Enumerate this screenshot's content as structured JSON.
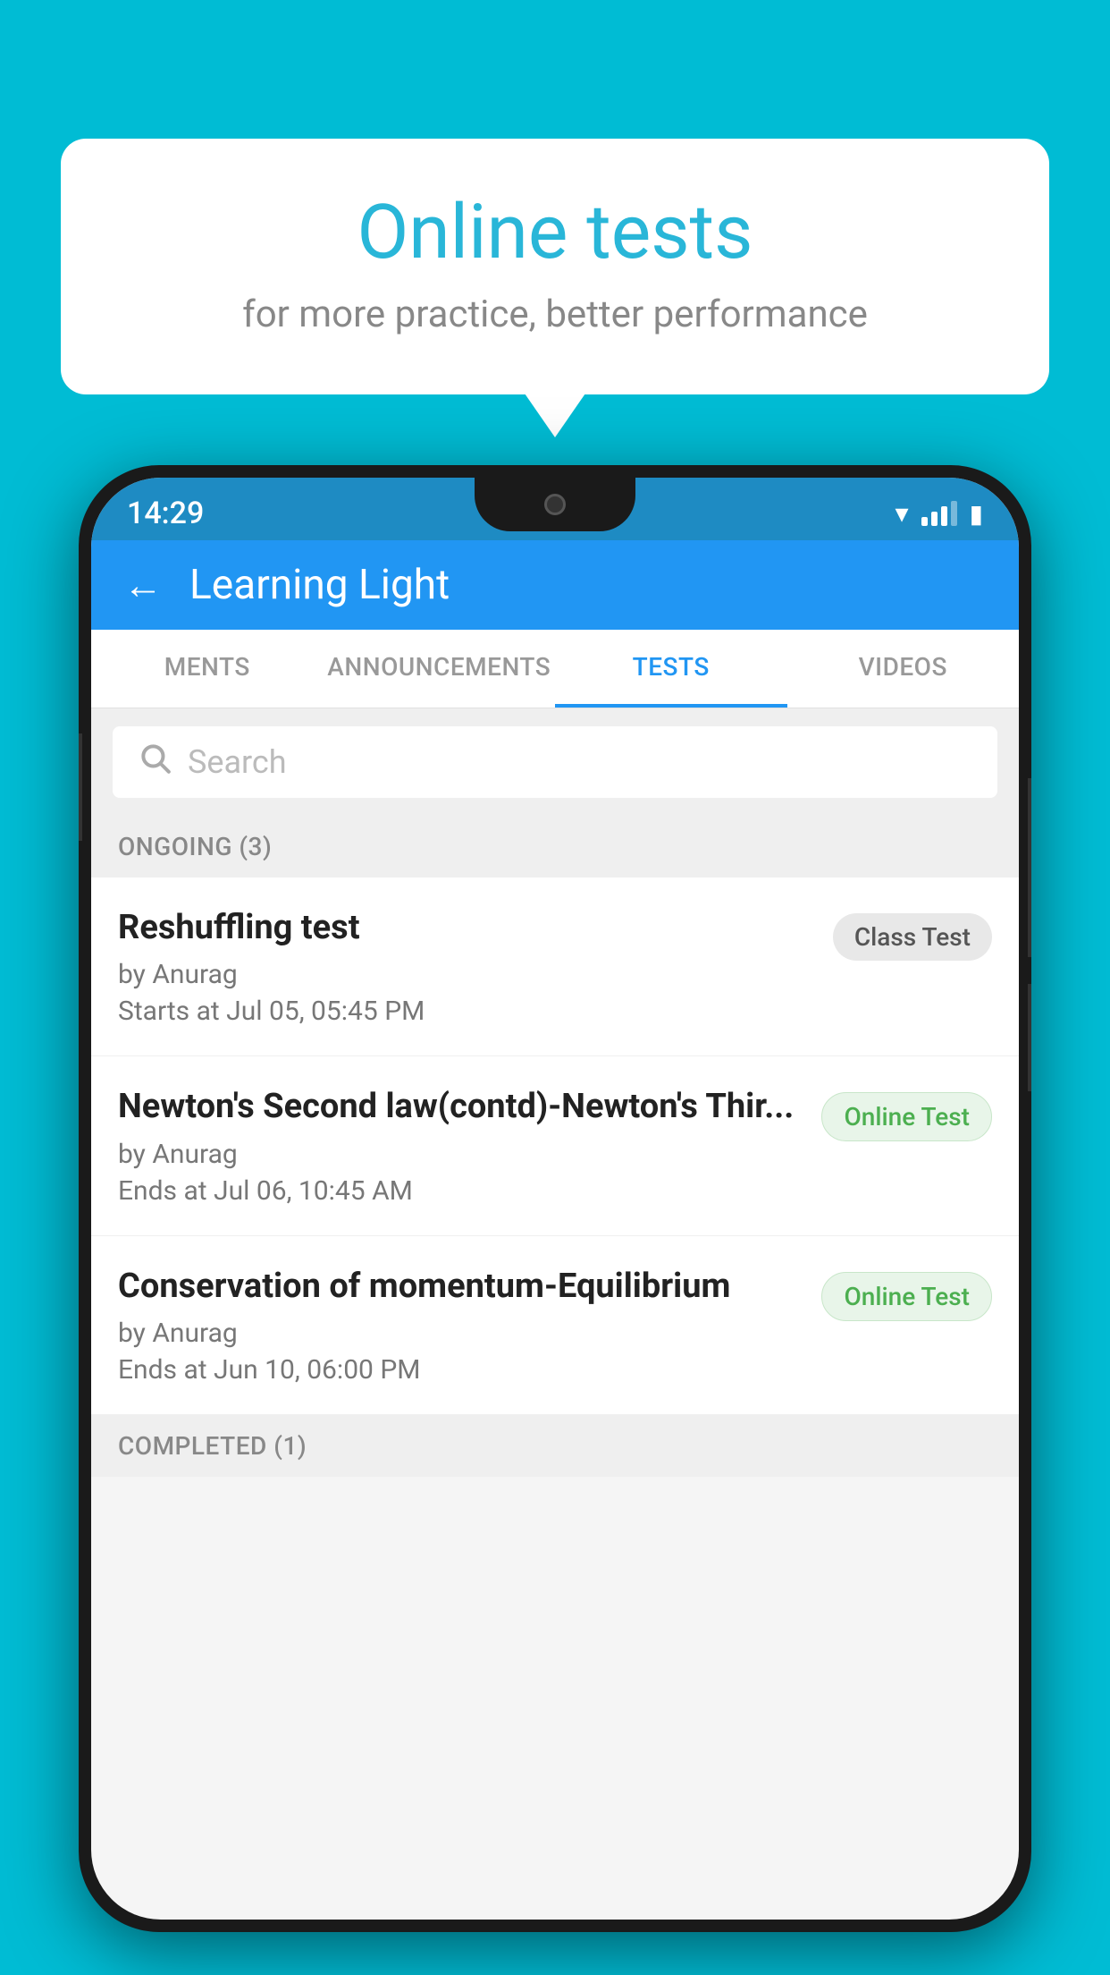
{
  "background_color": "#00bcd4",
  "speech_bubble": {
    "title": "Online tests",
    "subtitle": "for more practice, better performance"
  },
  "phone": {
    "status_bar": {
      "time": "14:29"
    },
    "app_header": {
      "title": "Learning Light",
      "back_label": "←"
    },
    "tabs": [
      {
        "label": "MENTS",
        "active": false
      },
      {
        "label": "ANNOUNCEMENTS",
        "active": false
      },
      {
        "label": "TESTS",
        "active": true
      },
      {
        "label": "VIDEOS",
        "active": false
      }
    ],
    "search": {
      "placeholder": "Search"
    },
    "ongoing_section": {
      "label": "ONGOING (3)"
    },
    "tests": [
      {
        "name": "Reshuffling test",
        "author": "by Anurag",
        "time": "Starts at  Jul 05, 05:45 PM",
        "badge": "Class Test",
        "badge_type": "class"
      },
      {
        "name": "Newton's Second law(contd)-Newton's Thir...",
        "author": "by Anurag",
        "time": "Ends at  Jul 06, 10:45 AM",
        "badge": "Online Test",
        "badge_type": "online"
      },
      {
        "name": "Conservation of momentum-Equilibrium",
        "author": "by Anurag",
        "time": "Ends at  Jun 10, 06:00 PM",
        "badge": "Online Test",
        "badge_type": "online"
      }
    ],
    "completed_section": {
      "label": "COMPLETED (1)"
    }
  }
}
